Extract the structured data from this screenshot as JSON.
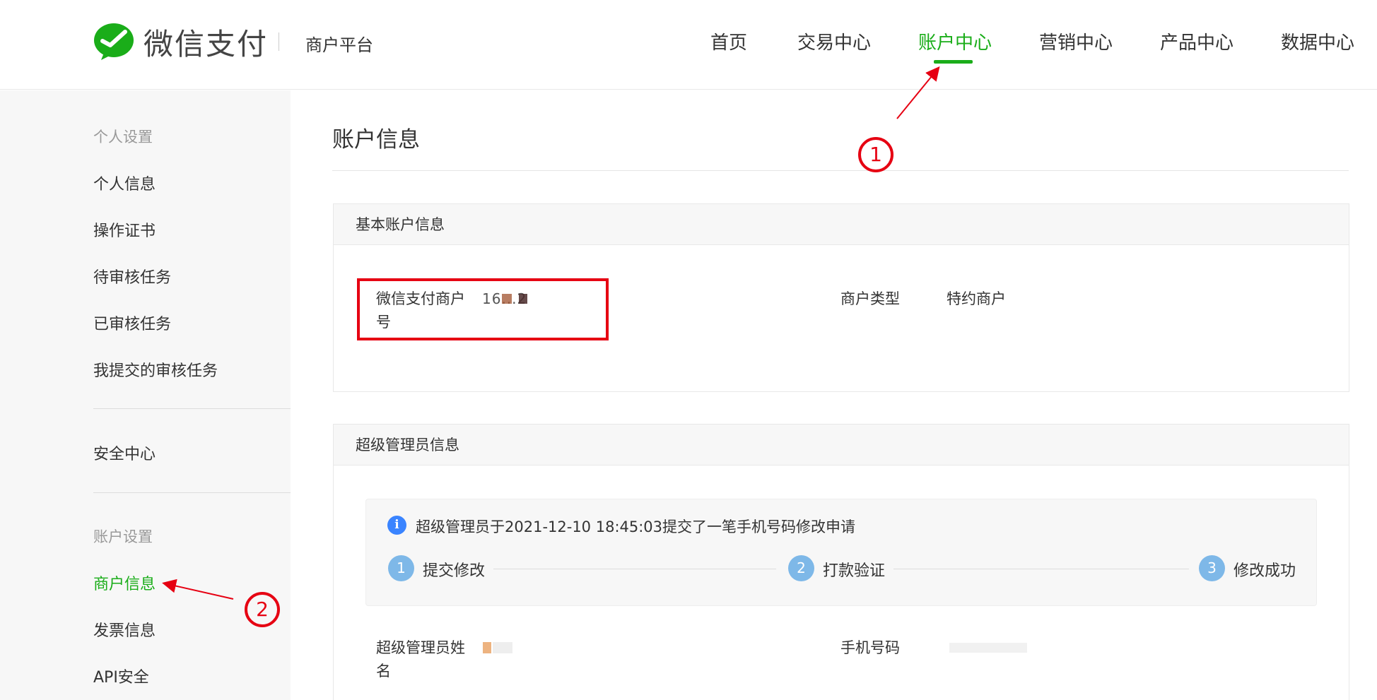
{
  "header": {
    "brand": "微信支付",
    "platform": "商户平台",
    "nav": [
      {
        "label": "首页"
      },
      {
        "label": "交易中心"
      },
      {
        "label": "账户中心"
      },
      {
        "label": "营销中心"
      },
      {
        "label": "产品中心"
      },
      {
        "label": "数据中心"
      }
    ],
    "active_nav": "账户中心"
  },
  "sidebar": {
    "group1": "个人设置",
    "items1": [
      "个人信息",
      "操作证书",
      "待审核任务",
      "已审核任务",
      "我提交的审核任务"
    ],
    "security": "安全中心",
    "group2": "账户设置",
    "items2": [
      "商户信息",
      "发票信息",
      "API安全"
    ],
    "active_item": "商户信息"
  },
  "main": {
    "title": "账户信息",
    "basic": {
      "heading": "基本账户信息",
      "merchant_id_label_line1": "微信支付商户",
      "merchant_id_label_line2": "号",
      "merchant_id_value": "16...2",
      "merchant_type_label": "商户类型",
      "merchant_type_value": "特约商户"
    },
    "admin": {
      "heading": "超级管理员信息",
      "notice": "超级管理员于2021-12-10 18:45:03提交了一笔手机号码修改申请",
      "steps": [
        {
          "num": "1",
          "label": "提交修改"
        },
        {
          "num": "2",
          "label": "打款验证"
        },
        {
          "num": "3",
          "label": "修改成功"
        }
      ],
      "name_label_line1": "超级管理员姓",
      "name_label_line2": "名",
      "phone_label": "手机号码"
    }
  },
  "annotations": {
    "badge1": "1",
    "badge2": "2"
  },
  "colors": {
    "accent": "#1aad19",
    "annotation": "#e60012",
    "step": "#7eb8e8",
    "info": "#3a84ff"
  }
}
